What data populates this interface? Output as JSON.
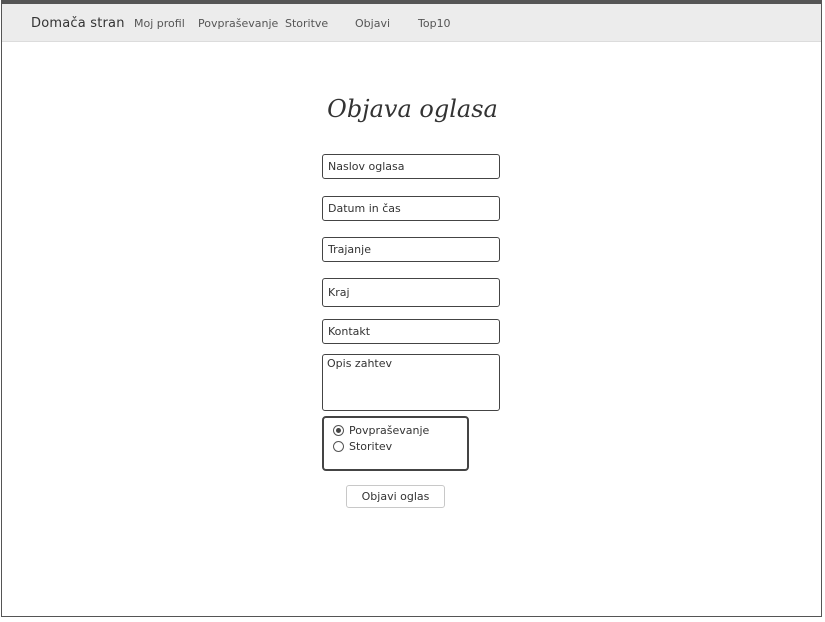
{
  "navbar": {
    "brand": "Domača stran",
    "links": [
      "Moj profil",
      "Povpraševanje",
      "Storitve",
      "Objavi",
      "Top10"
    ]
  },
  "form": {
    "title": "Objava oglasa",
    "fields": {
      "naslov": "Naslov oglasa",
      "datum": "Datum in čas",
      "trajanje": "Trajanje",
      "kraj": "Kraj",
      "kontakt": "Kontakt",
      "opis": "Opis zahtev"
    },
    "type_options": [
      {
        "label": "Povpraševanje",
        "checked": true
      },
      {
        "label": "Storitev",
        "checked": false
      }
    ],
    "submit_label": "Objavi oglas"
  }
}
